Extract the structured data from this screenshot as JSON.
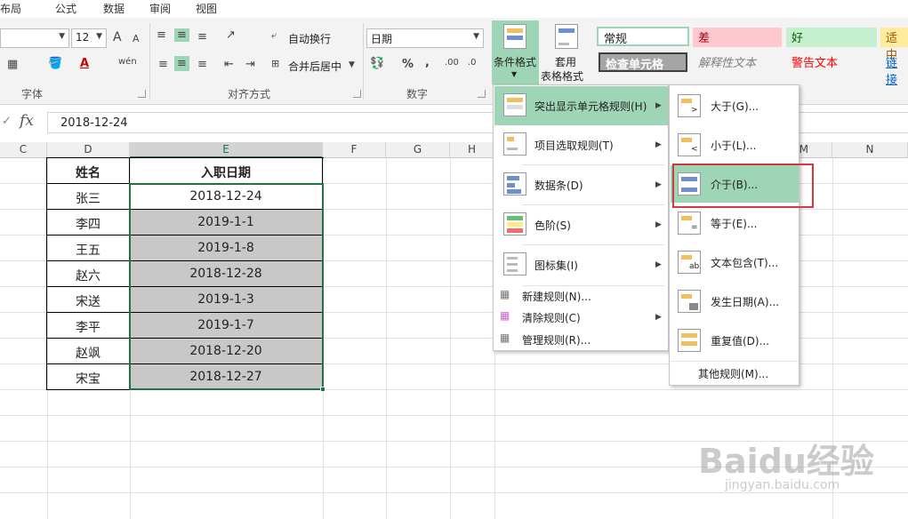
{
  "tabs": [
    "布局",
    "公式",
    "数据",
    "审阅",
    "视图"
  ],
  "font": {
    "size": "12",
    "group_label": "字体",
    "grow": "A",
    "shrink": "A"
  },
  "alignment": {
    "wrap_text": "自动换行",
    "merge_center": "合并后居中",
    "group_label": "对齐方式"
  },
  "number": {
    "format": "日期",
    "percent": "%",
    "comma": ",",
    "group_label": "数字"
  },
  "styles_group": {
    "conditional_format": "条件格式",
    "table_format_1": "套用",
    "table_format_2": "表格格式",
    "normal": "常规",
    "bad": "差",
    "good": "好",
    "neutral": "适中",
    "check_cell": "检查单元格",
    "explanatory": "解释性文本",
    "warning": "警告文本",
    "link": "链接"
  },
  "formula_bar": {
    "fx": "fx",
    "value": "2018-12-24"
  },
  "columns": [
    "C",
    "D",
    "E",
    "F",
    "G",
    "H",
    "M",
    "N"
  ],
  "table": {
    "headers": [
      "姓名",
      "入职日期"
    ],
    "rows": [
      [
        "张三",
        "2018-12-24"
      ],
      [
        "李四",
        "2019-1-1"
      ],
      [
        "王五",
        "2019-1-8"
      ],
      [
        "赵六",
        "2018-12-28"
      ],
      [
        "宋送",
        "2019-1-3"
      ],
      [
        "李平",
        "2019-1-7"
      ],
      [
        "赵飒",
        "2018-12-20"
      ],
      [
        "宋宝",
        "2018-12-27"
      ]
    ]
  },
  "cf_menu": {
    "items": [
      "突出显示单元格规则(H)",
      "项目选取规则(T)",
      "数据条(D)",
      "色阶(S)",
      "图标集(I)",
      "新建规则(N)...",
      "清除规则(C)",
      "管理规则(R)..."
    ]
  },
  "highlight_menu": {
    "items": [
      "大于(G)...",
      "小于(L)...",
      "介于(B)...",
      "等于(E)...",
      "文本包含(T)...",
      "发生日期(A)...",
      "重复值(D)...",
      "其他规则(M)..."
    ]
  },
  "watermark": {
    "brand": "Baidu经验",
    "url": "jingyan.baidu.com"
  },
  "colors": {
    "highlight": "#9fd5b7",
    "excel_green": "#217346",
    "red_box": "#d9363e"
  }
}
